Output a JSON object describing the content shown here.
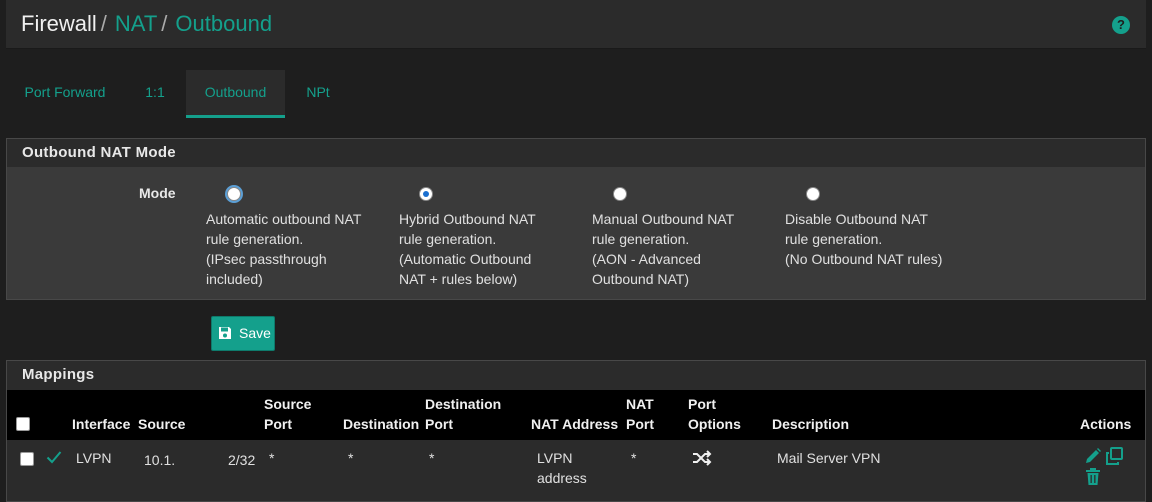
{
  "breadcrumb": {
    "first": "Firewall",
    "second": "NAT",
    "third": "Outbound",
    "separator": "/"
  },
  "help_icon": "question-icon",
  "tabs": [
    {
      "label": "Port Forward",
      "active": false
    },
    {
      "label": "1:1",
      "active": false
    },
    {
      "label": "Outbound",
      "active": true
    },
    {
      "label": "NPt",
      "active": false
    }
  ],
  "mode_panel": {
    "title": "Outbound NAT Mode",
    "mode_label": "Mode",
    "options": [
      {
        "lines": [
          "Automatic outbound NAT",
          "rule generation.",
          "(IPsec passthrough",
          "included)"
        ],
        "checked": false,
        "focused": true
      },
      {
        "lines": [
          "Hybrid Outbound NAT",
          "rule generation.",
          "(Automatic Outbound",
          "NAT + rules below)"
        ],
        "checked": true,
        "focused": false
      },
      {
        "lines": [
          "Manual Outbound NAT",
          "rule generation.",
          "(AON - Advanced",
          "Outbound NAT)"
        ],
        "checked": false,
        "focused": false
      },
      {
        "lines": [
          "Disable Outbound NAT",
          "rule generation.",
          "(No Outbound NAT rules)"
        ],
        "checked": false,
        "focused": false
      }
    ]
  },
  "save_button": {
    "label": "Save",
    "icon": "floppy-disk-icon"
  },
  "mappings": {
    "title": "Mappings",
    "columns": {
      "interface": "Interface",
      "source": "Source",
      "source_port": [
        "Source",
        "Port"
      ],
      "destination": "Destination",
      "destination_port": [
        "Destination",
        "Port"
      ],
      "nat_address": "NAT Address",
      "nat_port": [
        "NAT",
        "Port"
      ],
      "port_options": [
        "Port",
        "Options"
      ],
      "description": "Description",
      "actions": "Actions"
    },
    "rows": [
      {
        "enabled_icon": "check-icon",
        "interface": "LVPN",
        "source_left": "10.1.",
        "source_right": "2/32",
        "source_port": "*",
        "destination": "*",
        "destination_port": "*",
        "nat_address": [
          "LVPN",
          "address"
        ],
        "nat_port": "*",
        "port_options_icon": "shuffle-icon",
        "description": "Mail Server VPN",
        "action_icons": [
          "pencil-icon",
          "copy-icon",
          "trash-icon"
        ]
      }
    ]
  },
  "colors": {
    "accent": "#14a08c",
    "background": "#1e1e1e",
    "panel": "#3a3a3a",
    "header": "#2b2b2b",
    "table_head": "#000000"
  }
}
